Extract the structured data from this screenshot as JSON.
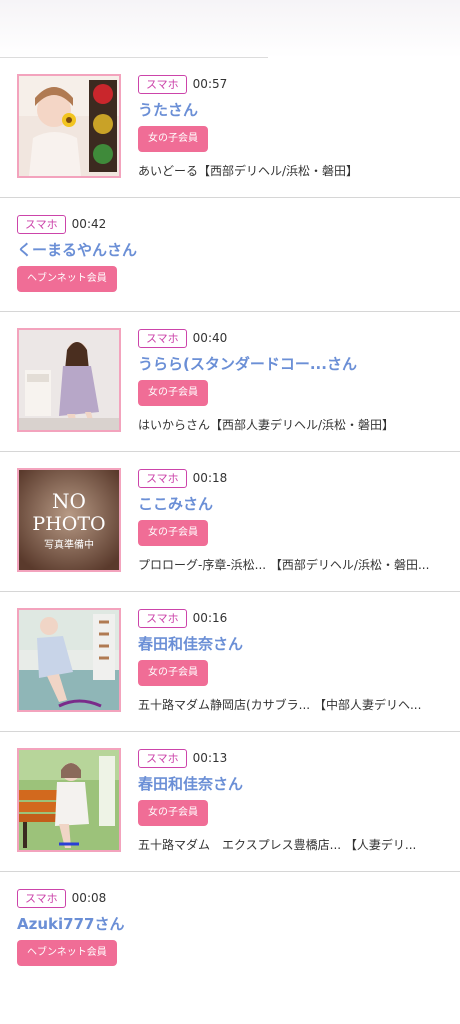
{
  "entries": [
    {
      "device": "スマホ",
      "time": "00:57",
      "name": "うたさん",
      "member": "女の子会員",
      "shop": "あいどーる【西部デリヘル/浜松・磐田】"
    },
    {
      "device": "スマホ",
      "time": "00:42",
      "name": "くーまるやんさん",
      "member": "ヘブンネット会員"
    },
    {
      "device": "スマホ",
      "time": "00:40",
      "name": "うらら(スタンダードコー...さん",
      "member": "女の子会員",
      "shop": "はいからさん【西部人妻デリヘル/浜松・磐田】"
    },
    {
      "device": "スマホ",
      "time": "00:18",
      "name": "ここみさん",
      "member": "女の子会員",
      "shop": "プロローグ-序章-浜松... 【西部デリヘル/浜松・磐田..."
    },
    {
      "device": "スマホ",
      "time": "00:16",
      "name": "春田和佳奈さん",
      "member": "女の子会員",
      "shop": "五十路マダム静岡店(カサブラ... 【中部人妻デリヘ..."
    },
    {
      "device": "スマホ",
      "time": "00:13",
      "name": "春田和佳奈さん",
      "member": "女の子会員",
      "shop": "五十路マダム　エクスプレス豊橋店... 【人妻デリ..."
    },
    {
      "device": "スマホ",
      "time": "00:08",
      "name": "Azuki777さん",
      "member": "ヘブンネット会員"
    }
  ],
  "thumbs": {
    "nophoto_line1": "NO",
    "nophoto_line2": "PHOTO",
    "nophoto_line3": "写真準備中"
  },
  "colors": {
    "device_badge": "#cc44aa",
    "name": "#6b8fd6",
    "member_badge": "#f06d96",
    "thumb_border": "#f3a3bd"
  }
}
